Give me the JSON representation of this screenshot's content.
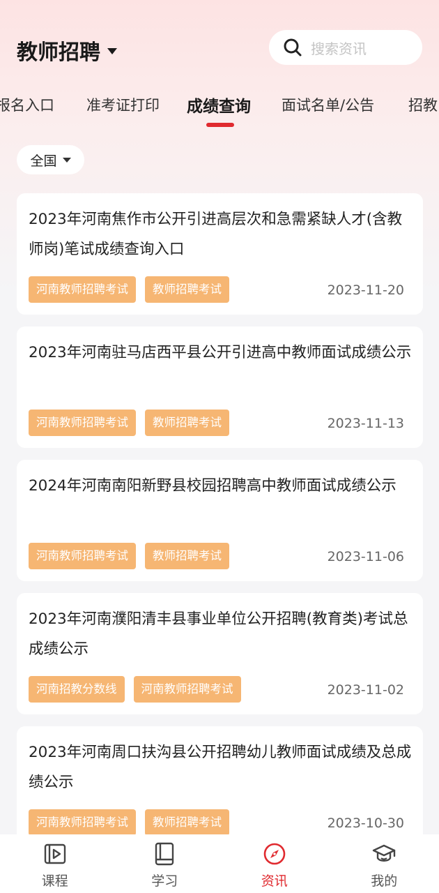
{
  "header": {
    "title": "教师招聘",
    "search_placeholder": "搜索资讯"
  },
  "tabs": [
    {
      "label": "报名入口",
      "active": false
    },
    {
      "label": "准考证打印",
      "active": false
    },
    {
      "label": "成绩查询",
      "active": true
    },
    {
      "label": "面试名单/公告",
      "active": false
    },
    {
      "label": "招教",
      "active": false
    }
  ],
  "filter": {
    "region": "全国"
  },
  "articles": [
    {
      "title": "2023年河南焦作市公开引进高层次和急需紧缺人才(含教师岗)笔试成绩查询入口",
      "tags": [
        "河南教师招聘考试",
        "教师招聘考试"
      ],
      "date": "2023-11-20"
    },
    {
      "title": "2023年河南驻马店西平县公开引进高中教师面试成绩公示",
      "tags": [
        "河南教师招聘考试",
        "教师招聘考试"
      ],
      "date": "2023-11-13"
    },
    {
      "title": "2024年河南南阳新野县校园招聘高中教师面试成绩公示",
      "tags": [
        "河南教师招聘考试",
        "教师招聘考试"
      ],
      "date": "2023-11-06"
    },
    {
      "title": "2023年河南濮阳清丰县事业单位公开招聘(教育类)考试总成绩公示",
      "tags": [
        "河南招教分数线",
        "河南教师招聘考试"
      ],
      "date": "2023-11-02"
    },
    {
      "title": "2023年河南周口扶沟县公开招聘幼儿教师面试成绩及总成绩公示",
      "tags": [
        "河南教师招聘考试",
        "教师招聘考试"
      ],
      "date": "2023-10-30"
    }
  ],
  "bottom_nav": [
    {
      "label": "课程",
      "icon": "video-course-icon",
      "active": false
    },
    {
      "label": "学习",
      "icon": "book-icon",
      "active": false
    },
    {
      "label": "资讯",
      "icon": "compass-icon",
      "active": true
    },
    {
      "label": "我的",
      "icon": "graduation-cap-icon",
      "active": false
    }
  ],
  "colors": {
    "accent": "#e02a2f",
    "tag": "#f6b673",
    "nav_active": "#e02a2f"
  }
}
